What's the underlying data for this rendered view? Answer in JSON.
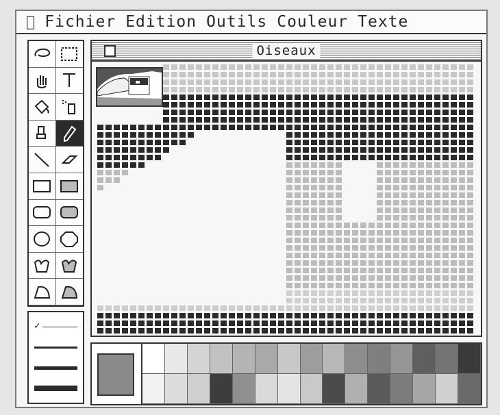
{
  "menubar": {
    "items": [
      "Fichier",
      "Edition",
      "Outils",
      "Couleur",
      "Texte"
    ]
  },
  "window": {
    "title": "Oiseaux"
  },
  "tools": [
    {
      "name": "lasso-tool",
      "icon": "lasso-icon"
    },
    {
      "name": "marquee-tool",
      "icon": "marquee-icon"
    },
    {
      "name": "grabber-tool",
      "icon": "hand-icon"
    },
    {
      "name": "text-tool",
      "icon": "text-icon",
      "glyph": "T"
    },
    {
      "name": "fill-tool",
      "icon": "paint-bucket-icon"
    },
    {
      "name": "spray-tool",
      "icon": "spray-can-icon"
    },
    {
      "name": "brush-tool",
      "icon": "brush-icon"
    },
    {
      "name": "pencil-tool",
      "icon": "pencil-icon",
      "selected": true
    },
    {
      "name": "line-tool",
      "icon": "line-icon"
    },
    {
      "name": "eraser-tool",
      "icon": "eraser-icon"
    },
    {
      "name": "rectangle-tool",
      "icon": "rectangle-icon"
    },
    {
      "name": "filled-rectangle-tool",
      "icon": "filled-rectangle-icon"
    },
    {
      "name": "rounded-rectangle-tool",
      "icon": "rounded-rectangle-icon"
    },
    {
      "name": "filled-rounded-rectangle-tool",
      "icon": "filled-rounded-rectangle-icon"
    },
    {
      "name": "oval-tool",
      "icon": "oval-icon"
    },
    {
      "name": "polygon-tool",
      "icon": "polygon-icon"
    },
    {
      "name": "freeform-tool",
      "icon": "freeform-icon"
    },
    {
      "name": "filled-freeform-tool",
      "icon": "filled-freeform-icon"
    },
    {
      "name": "curve-tool",
      "icon": "curve-icon"
    },
    {
      "name": "filled-curve-tool",
      "icon": "filled-curve-icon"
    }
  ],
  "line_widths": {
    "selected_index": 0,
    "check_mark": "✓"
  },
  "palette": {
    "current": "#8a8a8a",
    "top_row": [
      "#ffffff",
      "#e8e8e8",
      "#d4d4d4",
      "#c2c2c2",
      "#b4b4b4",
      "#a9a9a9",
      "#c8c8c8",
      "#9d9d9d",
      "#b8b8b8",
      "#8d8d8d",
      "#7f7f7f",
      "#969696",
      "#5f5f5f",
      "#747474",
      "#3a3a3a"
    ],
    "bottom_row": [
      "#f2f2f2",
      "#dcdcdc",
      "#cfcfcf",
      "#3d3d3d",
      "#909090",
      "#d9d9d9",
      "#e4e4e4",
      "#c9c9c9",
      "#4b4b4b",
      "#b0b0b0",
      "#5a5a5a",
      "#7c7c7c",
      "#a6a6a6",
      "#d0d0d0",
      "#6a6a6a"
    ]
  }
}
